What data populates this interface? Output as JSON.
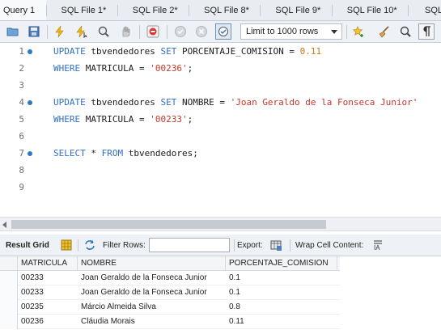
{
  "tabs": [
    {
      "label": "Query 1",
      "active": true
    },
    {
      "label": "SQL File 1*",
      "active": false
    },
    {
      "label": "SQL File 2*",
      "active": false
    },
    {
      "label": "SQL File 8*",
      "active": false
    },
    {
      "label": "SQL File 9*",
      "active": false
    },
    {
      "label": "SQL File 10*",
      "active": false
    },
    {
      "label": "SQL Fi",
      "active": false
    }
  ],
  "toolbar": {
    "limit_label": "Limit to 1000 rows"
  },
  "editor": {
    "line_numbers": [
      "1",
      "2",
      "3",
      "4",
      "5",
      "6",
      "7",
      "8",
      "9"
    ],
    "lines": [
      [
        {
          "t": "UPDATE",
          "c": "kw"
        },
        {
          "t": " tbvendedores ",
          "c": ""
        },
        {
          "t": "SET",
          "c": "kw"
        },
        {
          "t": " PORCENTAJE_COMISION = ",
          "c": ""
        },
        {
          "t": "0.11",
          "c": "num"
        }
      ],
      [
        {
          "t": "WHERE",
          "c": "kw"
        },
        {
          "t": " MATRICULA = ",
          "c": ""
        },
        {
          "t": "'00236'",
          "c": "str"
        },
        {
          "t": ";",
          "c": ""
        }
      ],
      [],
      [
        {
          "t": "UPDATE",
          "c": "kw"
        },
        {
          "t": " tbvendedores ",
          "c": ""
        },
        {
          "t": "SET",
          "c": "kw"
        },
        {
          "t": " NOMBRE = ",
          "c": ""
        },
        {
          "t": "'Joan Geraldo de la Fonseca Junior'",
          "c": "str"
        }
      ],
      [
        {
          "t": "WHERE",
          "c": "kw"
        },
        {
          "t": " MATRICULA = ",
          "c": ""
        },
        {
          "t": "'00233'",
          "c": "str"
        },
        {
          "t": ";",
          "c": ""
        }
      ],
      [],
      [
        {
          "t": "SELECT",
          "c": "kw"
        },
        {
          "t": " * ",
          "c": ""
        },
        {
          "t": "FROM",
          "c": "kw"
        },
        {
          "t": " tbvendedores;",
          "c": ""
        }
      ],
      [],
      []
    ],
    "dot_lines": [
      1,
      4,
      7
    ]
  },
  "result_toolbar": {
    "result_grid_label": "Result Grid",
    "filter_label": "Filter Rows:",
    "filter_value": "",
    "export_label": "Export:",
    "wrap_label": "Wrap Cell Content:"
  },
  "grid": {
    "columns": [
      "MATRICULA",
      "NOMBRE",
      "PORCENTAJE_COMISION"
    ],
    "rows": [
      [
        "00233",
        "Joan Geraldo de la Fonseca Junior",
        "0.1"
      ],
      [
        "00233",
        "Joan Geraldo de la Fonseca Junior",
        "0.1"
      ],
      [
        "00235",
        "Márcio Almeida Silva",
        "0.8"
      ],
      [
        "00236",
        "Cláudia Morais",
        "0.11"
      ]
    ]
  },
  "colors": {
    "keyword": "#2e6fc7",
    "string": "#c0392b",
    "number": "#d4701a",
    "marker_dot": "#2e79c7"
  }
}
